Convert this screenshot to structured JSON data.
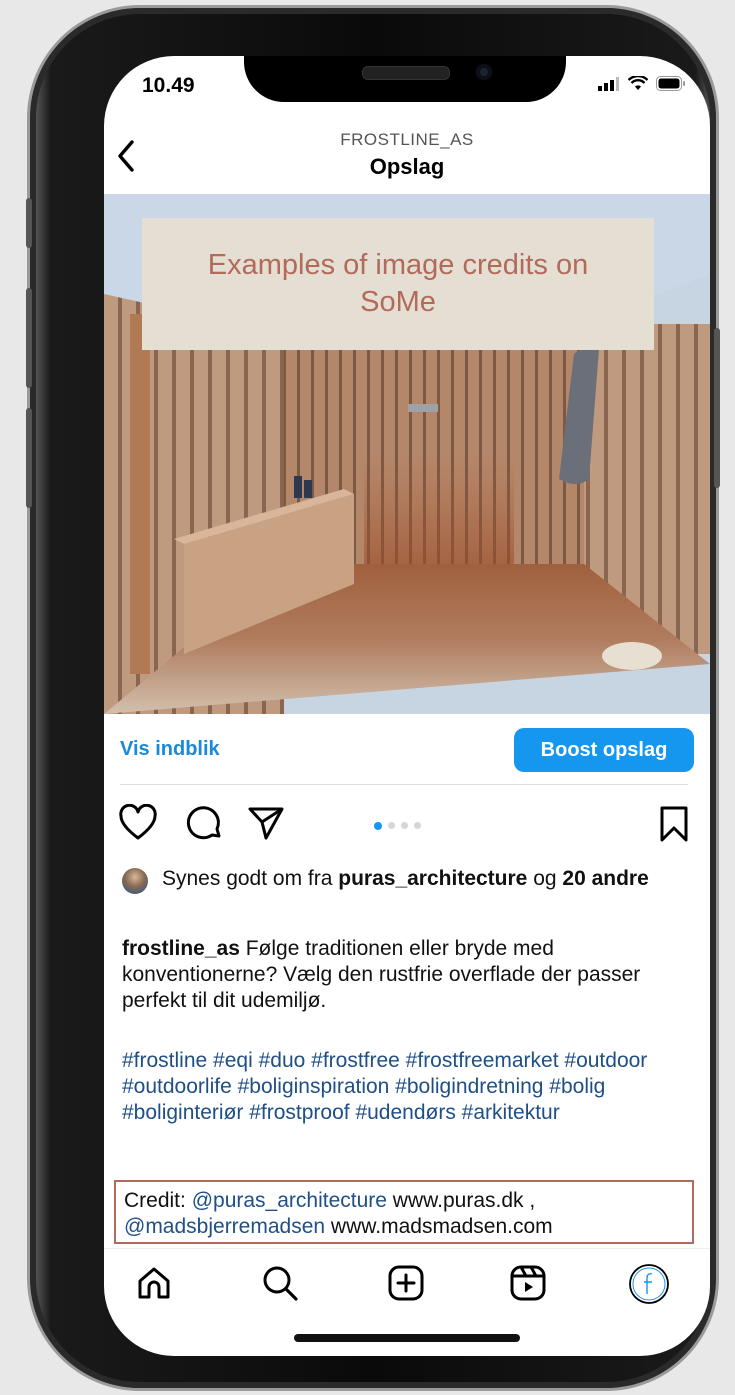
{
  "status_bar": {
    "time": "10.49"
  },
  "header": {
    "account": "FROSTLINE_AS",
    "title": "Opslag"
  },
  "post_image": {
    "overlay_text": "Examples of image credits on SoMe"
  },
  "actions": {
    "insights_link": "Vis indblik",
    "boost_button": "Boost opslag"
  },
  "carousel": {
    "count": 4,
    "active": 1
  },
  "likes": {
    "prefix": "Synes godt om fra",
    "user": "puras_architecture",
    "joiner": "og",
    "others": "20 andre"
  },
  "caption": {
    "username": "frostline_as",
    "text": "Følge traditionen eller bryde med konventionerne? Vælg den rustfrie overflade der passer perfekt til dit udemiljø."
  },
  "hashtags": "#frostline #eqi #duo #frostfree #frostfreemarket #outdoor #outdoorlife #boliginspiration #boligindretning #bolig #boliginteriør #frostproof #udendørs #arkitektur",
  "credit": {
    "label": "Credit:",
    "handle1": "@puras_architecture",
    "site1": "www.puras.dk ,",
    "handle2": "@madsbjerremadsen",
    "site2": "www.madsmadsen.com"
  },
  "colors": {
    "accent": "#1596ef",
    "credit_border": "#b06a5a",
    "overlay_text": "#b26a5b",
    "hashtag": "#1f4f86"
  },
  "tab_icons": [
    "home-icon",
    "search-icon",
    "create-icon",
    "reels-icon",
    "profile-icon"
  ]
}
